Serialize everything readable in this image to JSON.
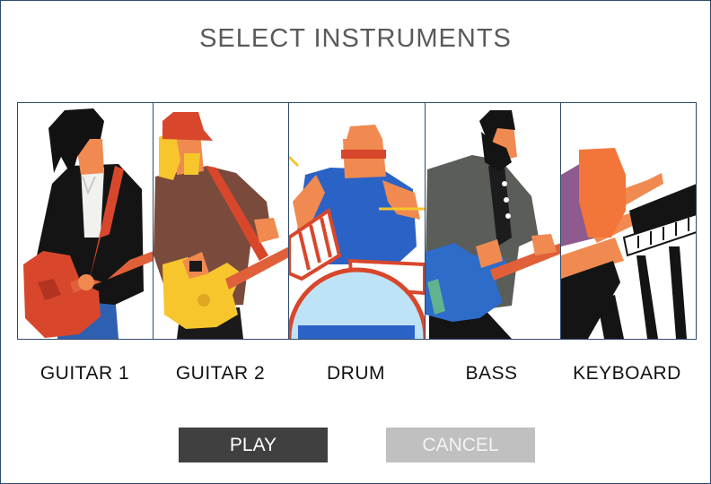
{
  "dialog": {
    "title": "SELECT INSTRUMENTS"
  },
  "instruments": [
    {
      "label": "GUITAR 1",
      "icon": "guitarist-1-illustration"
    },
    {
      "label": "GUITAR 2",
      "icon": "guitarist-2-illustration"
    },
    {
      "label": "DRUM",
      "icon": "drummer-illustration"
    },
    {
      "label": "BASS",
      "icon": "bassist-illustration"
    },
    {
      "label": "KEYBOARD",
      "icon": "keyboardist-illustration"
    }
  ],
  "buttons": {
    "play": "PLAY",
    "cancel": "CANCEL"
  },
  "colors": {
    "frame": "#2e4a6b",
    "play_bg": "#404040",
    "cancel_bg": "#c0c0c0",
    "skin": "#f08a50",
    "guitar_red": "#d8472b",
    "guitar_yellow": "#f6c62c",
    "drum_blue": "#2b62c6",
    "bass_blue": "#2d6cc8"
  }
}
